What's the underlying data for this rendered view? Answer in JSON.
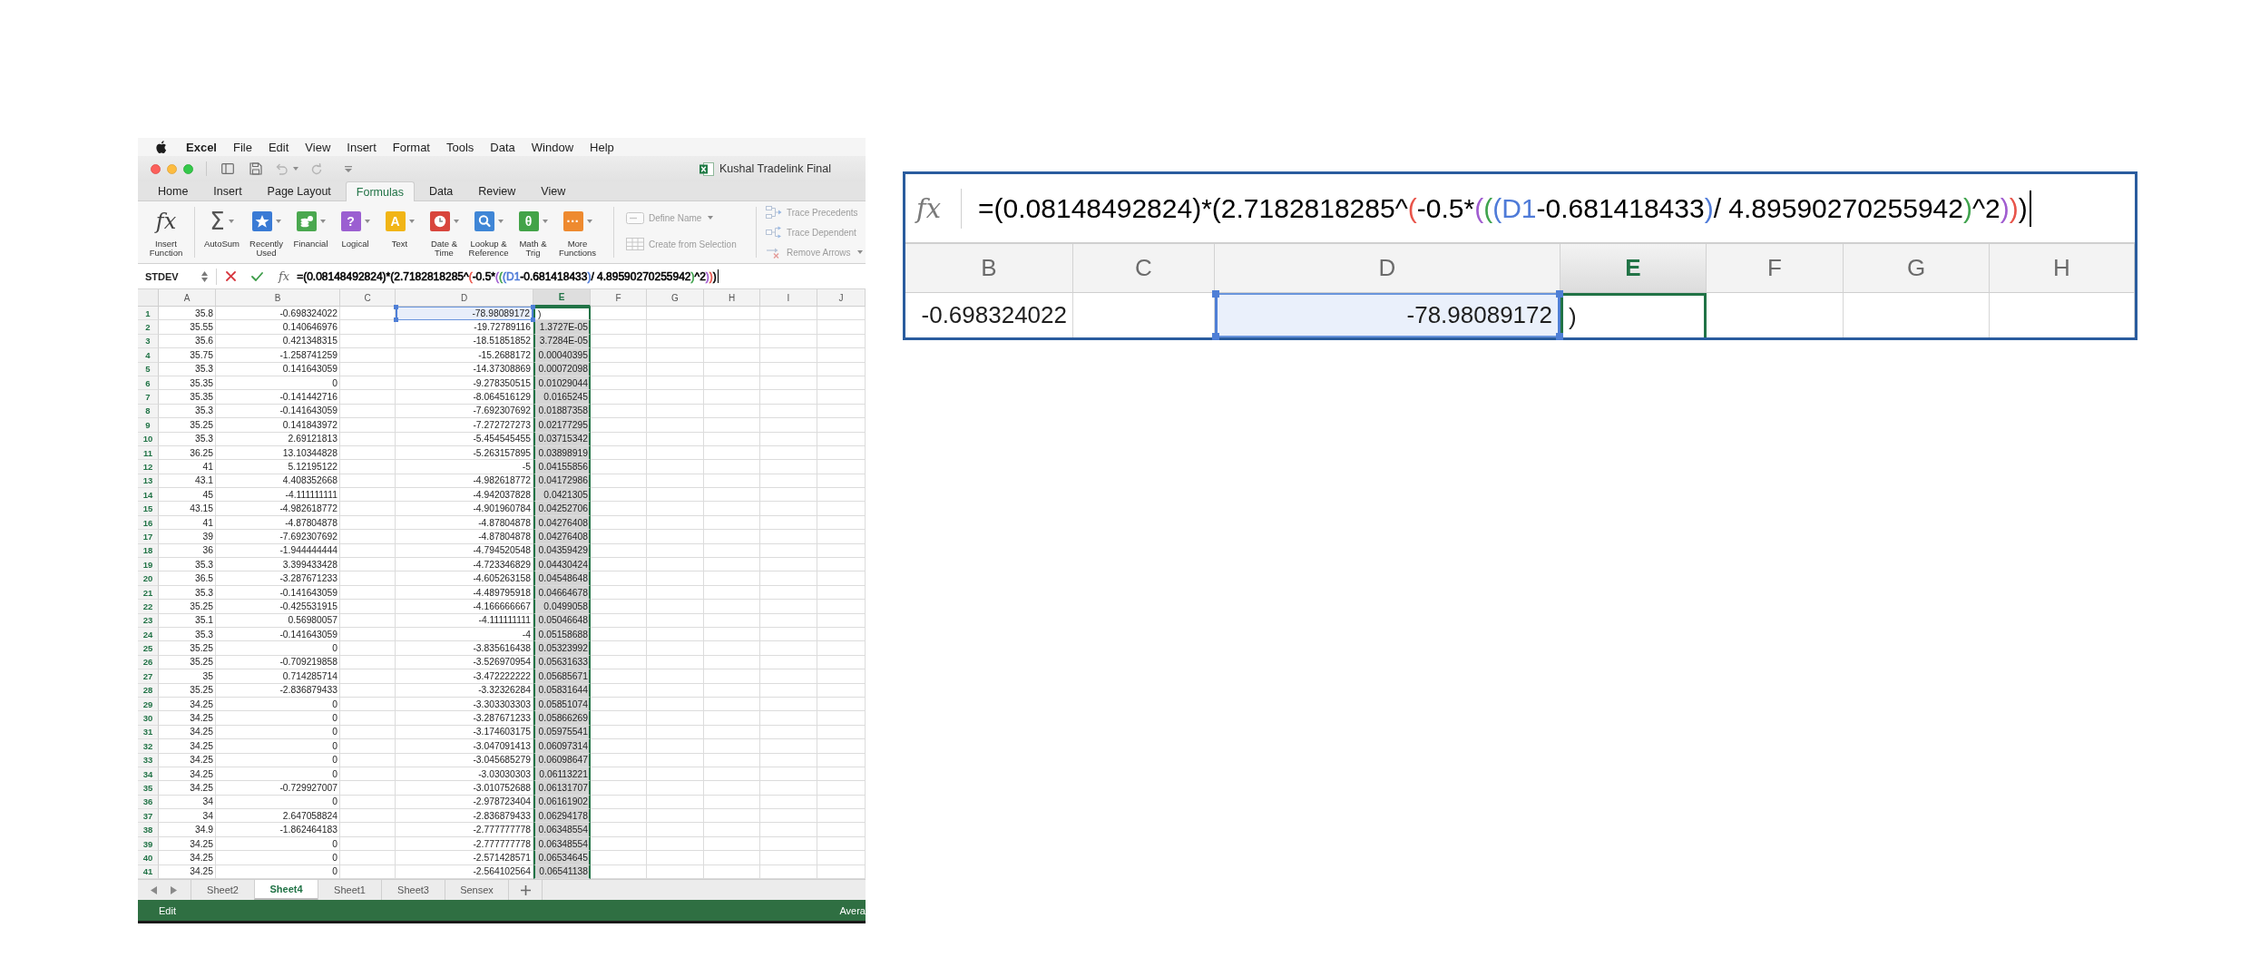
{
  "menu_bar": {
    "app": "Excel",
    "items": [
      "File",
      "Edit",
      "View",
      "Insert",
      "Format",
      "Tools",
      "Data",
      "Window",
      "Help"
    ]
  },
  "window": {
    "title": "Kushal Tradelink Final"
  },
  "ribbon_tabs": [
    {
      "label": "Home",
      "selected": false
    },
    {
      "label": "Insert",
      "selected": false
    },
    {
      "label": "Page Layout",
      "selected": false
    },
    {
      "label": "Formulas",
      "selected": true
    },
    {
      "label": "Data",
      "selected": false
    },
    {
      "label": "Review",
      "selected": false
    },
    {
      "label": "View",
      "selected": false
    }
  ],
  "ribbon": {
    "insert_function": {
      "glyph": "fx",
      "label": "Insert\nFunction"
    },
    "function_buttons": [
      {
        "kind": "sigma",
        "glyph": "Σ",
        "label": "AutoSum"
      },
      {
        "kind": "star",
        "color": "#3a7bd5",
        "label": "Recently\nUsed"
      },
      {
        "kind": "coins",
        "color": "#4aa84f",
        "label": "Financial"
      },
      {
        "kind": "question",
        "glyph": "?",
        "color": "#9b5fd1",
        "label": "Logical"
      },
      {
        "kind": "letter",
        "glyph": "A",
        "color": "#f1b516",
        "label": "Text"
      },
      {
        "kind": "clock",
        "color": "#d8463d",
        "label": "Date &\nTime"
      },
      {
        "kind": "magnifier",
        "color": "#3f86d6",
        "label": "Lookup &\nReference"
      },
      {
        "kind": "theta",
        "glyph": "θ",
        "color": "#43a348",
        "label": "Math &\nTrig"
      },
      {
        "kind": "ellipsis",
        "glyph": "···",
        "color": "#ee8a2f",
        "label": "More\nFunctions"
      }
    ],
    "name_commands": [
      {
        "kind": "tag",
        "label": "Define Name",
        "disabled": true,
        "dropdown": true
      },
      {
        "kind": "table",
        "label": "Create from Selection",
        "disabled": true,
        "dropdown": false
      }
    ],
    "audit_commands": [
      {
        "kind": "precedents",
        "label": "Trace Precedents",
        "disabled": true,
        "dropdown": false
      },
      {
        "kind": "dependents",
        "label": "Trace Dependent",
        "disabled": true,
        "dropdown": false
      },
      {
        "kind": "remove",
        "label": "Remove Arrows",
        "disabled": true,
        "dropdown": true
      }
    ]
  },
  "formula_bar": {
    "name_box": "STDEV",
    "fx": "fx",
    "formula": [
      {
        "text": "=(0.08148492824)*(2.7182818285^",
        "color": "#000000"
      },
      {
        "text": "(",
        "color": "#e8544a"
      },
      {
        "text": "-0.5*",
        "color": "#000000"
      },
      {
        "text": "(",
        "color": "#a05cd0"
      },
      {
        "text": "(",
        "color": "#3fa34d"
      },
      {
        "text": "(",
        "color": "#4f7bd8"
      },
      {
        "text": "D1",
        "color": "#4f7bd8"
      },
      {
        "text": "-0.681418433",
        "color": "#000000"
      },
      {
        "text": ")",
        "color": "#4f7bd8"
      },
      {
        "text": "/ 4.89590270255942",
        "color": "#000000"
      },
      {
        "text": ")",
        "color": "#3fa34d"
      },
      {
        "text": "^2",
        "color": "#000000"
      },
      {
        "text": ")",
        "color": "#a05cd0"
      },
      {
        "text": ")",
        "color": "#e8544a"
      },
      {
        "text": ")",
        "color": "#000000"
      }
    ]
  },
  "sheet": {
    "columns": [
      {
        "label": "A",
        "selected": false
      },
      {
        "label": "B",
        "selected": false
      },
      {
        "label": "C",
        "selected": false
      },
      {
        "label": "D",
        "selected": false
      },
      {
        "label": "E",
        "selected": true
      },
      {
        "label": "F",
        "selected": false
      },
      {
        "label": "G",
        "selected": false
      },
      {
        "label": "H",
        "selected": false
      },
      {
        "label": "I",
        "selected": false
      },
      {
        "label": "J",
        "selected": false
      }
    ],
    "rows": [
      {
        "number": "1",
        "selected": true,
        "active": true,
        "d_highlighted": true,
        "a": "35.8",
        "b": "-0.698324022",
        "d": "-78.98089172",
        "e": ")"
      },
      {
        "number": "2",
        "selected": true,
        "active": false,
        "d_highlighted": false,
        "a": "35.55",
        "b": "0.140646976",
        "d": "-19.72789116",
        "e": "1.3727E-05"
      },
      {
        "number": "3",
        "selected": true,
        "active": false,
        "d_highlighted": false,
        "a": "35.6",
        "b": "0.421348315",
        "d": "-18.51851852",
        "e": "3.7284E-05"
      },
      {
        "number": "4",
        "selected": true,
        "active": false,
        "d_highlighted": false,
        "a": "35.75",
        "b": "-1.258741259",
        "d": "-15.2688172",
        "e": "0.00040395"
      },
      {
        "number": "5",
        "selected": true,
        "active": false,
        "d_highlighted": false,
        "a": "35.3",
        "b": "0.141643059",
        "d": "-14.37308869",
        "e": "0.00072098"
      },
      {
        "number": "6",
        "selected": true,
        "active": false,
        "d_highlighted": false,
        "a": "35.35",
        "b": "0",
        "d": "-9.278350515",
        "e": "0.01029044"
      },
      {
        "number": "7",
        "selected": true,
        "active": false,
        "d_highlighted": false,
        "a": "35.35",
        "b": "-0.141442716",
        "d": "-8.064516129",
        "e": "0.0165245"
      },
      {
        "number": "8",
        "selected": true,
        "active": false,
        "d_highlighted": false,
        "a": "35.3",
        "b": "-0.141643059",
        "d": "-7.692307692",
        "e": "0.01887358"
      },
      {
        "number": "9",
        "selected": true,
        "active": false,
        "d_highlighted": false,
        "a": "35.25",
        "b": "0.141843972",
        "d": "-7.272727273",
        "e": "0.02177295"
      },
      {
        "number": "10",
        "selected": true,
        "active": false,
        "d_highlighted": false,
        "a": "35.3",
        "b": "2.69121813",
        "d": "-5.454545455",
        "e": "0.03715342"
      },
      {
        "number": "11",
        "selected": true,
        "active": false,
        "d_highlighted": false,
        "a": "36.25",
        "b": "13.10344828",
        "d": "-5.263157895",
        "e": "0.03898919"
      },
      {
        "number": "12",
        "selected": true,
        "active": false,
        "d_highlighted": false,
        "a": "41",
        "b": "5.12195122",
        "d": "-5",
        "e": "0.04155856"
      },
      {
        "number": "13",
        "selected": true,
        "active": false,
        "d_highlighted": false,
        "a": "43.1",
        "b": "4.408352668",
        "d": "-4.982618772",
        "e": "0.04172986"
      },
      {
        "number": "14",
        "selected": true,
        "active": false,
        "d_highlighted": false,
        "a": "45",
        "b": "-4.111111111",
        "d": "-4.942037828",
        "e": "0.0421305"
      },
      {
        "number": "15",
        "selected": true,
        "active": false,
        "d_highlighted": false,
        "a": "43.15",
        "b": "-4.982618772",
        "d": "-4.901960784",
        "e": "0.04252706"
      },
      {
        "number": "16",
        "selected": true,
        "active": false,
        "d_highlighted": false,
        "a": "41",
        "b": "-4.87804878",
        "d": "-4.87804878",
        "e": "0.04276408"
      },
      {
        "number": "17",
        "selected": true,
        "active": false,
        "d_highlighted": false,
        "a": "39",
        "b": "-7.692307692",
        "d": "-4.87804878",
        "e": "0.04276408"
      },
      {
        "number": "18",
        "selected": true,
        "active": false,
        "d_highlighted": false,
        "a": "36",
        "b": "-1.944444444",
        "d": "-4.794520548",
        "e": "0.04359429"
      },
      {
        "number": "19",
        "selected": true,
        "active": false,
        "d_highlighted": false,
        "a": "35.3",
        "b": "3.399433428",
        "d": "-4.723346829",
        "e": "0.04430424"
      },
      {
        "number": "20",
        "selected": true,
        "active": false,
        "d_highlighted": false,
        "a": "36.5",
        "b": "-3.287671233",
        "d": "-4.605263158",
        "e": "0.04548648"
      },
      {
        "number": "21",
        "selected": true,
        "active": false,
        "d_highlighted": false,
        "a": "35.3",
        "b": "-0.141643059",
        "d": "-4.489795918",
        "e": "0.04664678"
      },
      {
        "number": "22",
        "selected": true,
        "active": false,
        "d_highlighted": false,
        "a": "35.25",
        "b": "-0.425531915",
        "d": "-4.166666667",
        "e": "0.0499058"
      },
      {
        "number": "23",
        "selected": true,
        "active": false,
        "d_highlighted": false,
        "a": "35.1",
        "b": "0.56980057",
        "d": "-4.111111111",
        "e": "0.05046648"
      },
      {
        "number": "24",
        "selected": true,
        "active": false,
        "d_highlighted": false,
        "a": "35.3",
        "b": "-0.141643059",
        "d": "-4",
        "e": "0.05158688"
      },
      {
        "number": "25",
        "selected": true,
        "active": false,
        "d_highlighted": false,
        "a": "35.25",
        "b": "0",
        "d": "-3.835616438",
        "e": "0.05323992"
      },
      {
        "number": "26",
        "selected": true,
        "active": false,
        "d_highlighted": false,
        "a": "35.25",
        "b": "-0.709219858",
        "d": "-3.526970954",
        "e": "0.05631633"
      },
      {
        "number": "27",
        "selected": true,
        "active": false,
        "d_highlighted": false,
        "a": "35",
        "b": "0.714285714",
        "d": "-3.472222222",
        "e": "0.05685671"
      },
      {
        "number": "28",
        "selected": true,
        "active": false,
        "d_highlighted": false,
        "a": "35.25",
        "b": "-2.836879433",
        "d": "-3.32326284",
        "e": "0.05831644"
      },
      {
        "number": "29",
        "selected": true,
        "active": false,
        "d_highlighted": false,
        "a": "34.25",
        "b": "0",
        "d": "-3.303303303",
        "e": "0.05851074"
      },
      {
        "number": "30",
        "selected": true,
        "active": false,
        "d_highlighted": false,
        "a": "34.25",
        "b": "0",
        "d": "-3.287671233",
        "e": "0.05866269"
      },
      {
        "number": "31",
        "selected": true,
        "active": false,
        "d_highlighted": false,
        "a": "34.25",
        "b": "0",
        "d": "-3.174603175",
        "e": "0.05975541"
      },
      {
        "number": "32",
        "selected": true,
        "active": false,
        "d_highlighted": false,
        "a": "34.25",
        "b": "0",
        "d": "-3.047091413",
        "e": "0.06097314"
      },
      {
        "number": "33",
        "selected": true,
        "active": false,
        "d_highlighted": false,
        "a": "34.25",
        "b": "0",
        "d": "-3.045685279",
        "e": "0.06098647"
      },
      {
        "number": "34",
        "selected": true,
        "active": false,
        "d_highlighted": false,
        "a": "34.25",
        "b": "0",
        "d": "-3.03030303",
        "e": "0.06113221"
      },
      {
        "number": "35",
        "selected": true,
        "active": false,
        "d_highlighted": false,
        "a": "34.25",
        "b": "-0.729927007",
        "d": "-3.010752688",
        "e": "0.06131707"
      },
      {
        "number": "36",
        "selected": true,
        "active": false,
        "d_highlighted": false,
        "a": "34",
        "b": "0",
        "d": "-2.978723404",
        "e": "0.06161902"
      },
      {
        "number": "37",
        "selected": true,
        "active": false,
        "d_highlighted": false,
        "a": "34",
        "b": "2.647058824",
        "d": "-2.836879433",
        "e": "0.06294178"
      },
      {
        "number": "38",
        "selected": true,
        "active": false,
        "d_highlighted": false,
        "a": "34.9",
        "b": "-1.862464183",
        "d": "-2.777777778",
        "e": "0.06348554"
      },
      {
        "number": "39",
        "selected": true,
        "active": false,
        "d_highlighted": false,
        "a": "34.25",
        "b": "0",
        "d": "-2.777777778",
        "e": "0.06348554"
      },
      {
        "number": "40",
        "selected": true,
        "active": false,
        "d_highlighted": false,
        "a": "34.25",
        "b": "0",
        "d": "-2.571428571",
        "e": "0.06534645"
      },
      {
        "number": "41",
        "selected": true,
        "active": false,
        "d_highlighted": false,
        "a": "34.25",
        "b": "0",
        "d": "-2.564102564",
        "e": "0.06541138"
      }
    ]
  },
  "sheet_tabs": [
    {
      "label": "Sheet2",
      "selected": false
    },
    {
      "label": "Sheet4",
      "selected": true
    },
    {
      "label": "Sheet1",
      "selected": false
    },
    {
      "label": "Sheet3",
      "selected": false
    },
    {
      "label": "Sensex",
      "selected": false
    }
  ],
  "status_bar": {
    "mode": "Edit",
    "summary": "Avera"
  },
  "inset": {
    "fx": "fx",
    "formula": [
      {
        "text": "=(0.08148492824)*(2.7182818285^",
        "color": "#000000"
      },
      {
        "text": "(",
        "color": "#e8544a"
      },
      {
        "text": "-0.5*",
        "color": "#000000"
      },
      {
        "text": "(",
        "color": "#a05cd0"
      },
      {
        "text": "(",
        "color": "#3fa34d"
      },
      {
        "text": "(",
        "color": "#4f7bd8"
      },
      {
        "text": "D1",
        "color": "#4f7bd8"
      },
      {
        "text": "-0.681418433",
        "color": "#000000"
      },
      {
        "text": ")",
        "color": "#4f7bd8"
      },
      {
        "text": "/ 4.89590270255942",
        "color": "#000000"
      },
      {
        "text": ")",
        "color": "#3fa34d"
      },
      {
        "text": "^2",
        "color": "#000000"
      },
      {
        "text": ")",
        "color": "#a05cd0"
      },
      {
        "text": ")",
        "color": "#e8544a"
      },
      {
        "text": ")",
        "color": "#000000"
      }
    ],
    "columns": [
      {
        "label": "B",
        "selected": false
      },
      {
        "label": "C",
        "selected": false
      },
      {
        "label": "D",
        "selected": false
      },
      {
        "label": "E",
        "selected": true
      },
      {
        "label": "F",
        "selected": false
      },
      {
        "label": "G",
        "selected": false
      },
      {
        "label": "H",
        "selected": false
      }
    ],
    "row": {
      "d_highlighted": true,
      "b": "-0.698324022",
      "d": "-78.98089172",
      "e": ")"
    }
  }
}
